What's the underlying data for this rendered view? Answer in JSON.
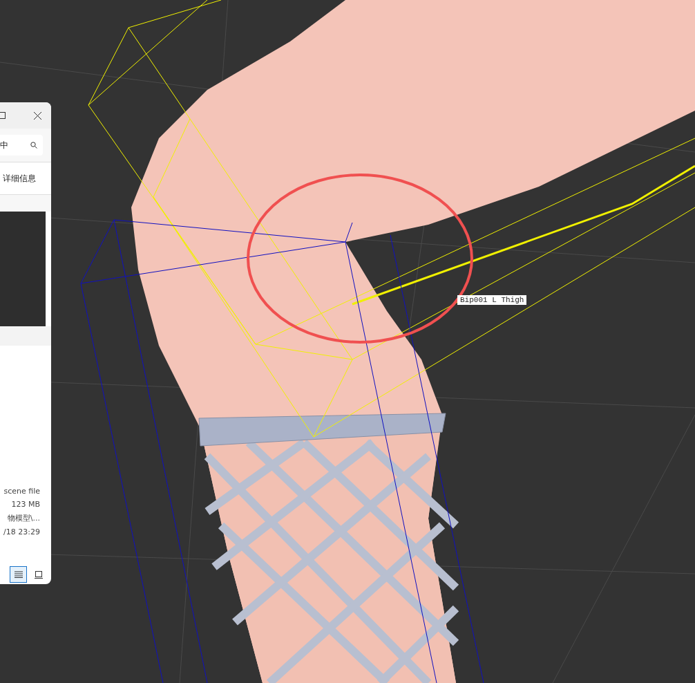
{
  "explorer": {
    "search_value": "中",
    "details_tab": "详细信息",
    "details": [
      "scene file",
      "123 MB",
      "物模型\\...",
      "/18 23:29"
    ],
    "view_buttons": [
      {
        "kind": "details",
        "selected": true
      },
      {
        "kind": "preview",
        "selected": false
      }
    ]
  },
  "viewport": {
    "bone_label": "Bip001 L Thigh"
  }
}
